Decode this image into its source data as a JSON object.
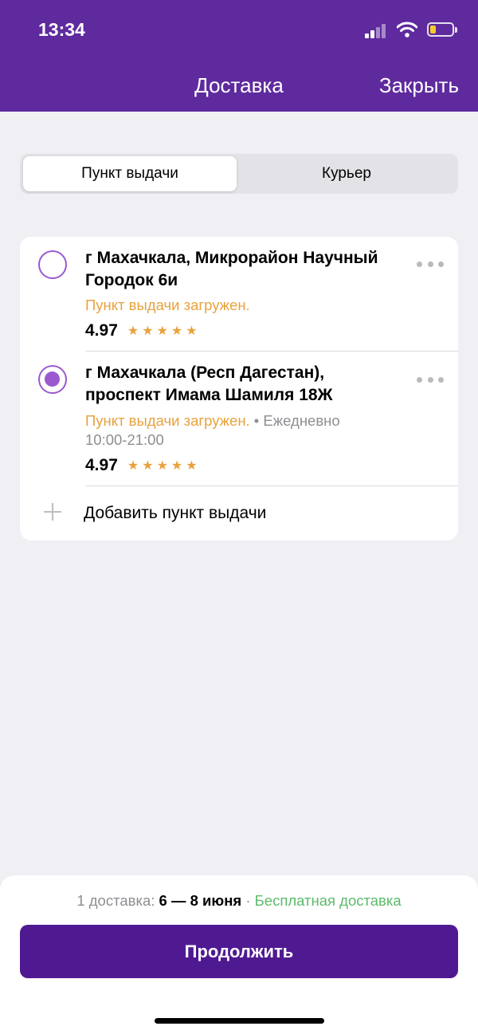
{
  "status_bar": {
    "time": "13:34"
  },
  "header": {
    "title": "Доставка",
    "close_label": "Закрыть"
  },
  "tabs": [
    {
      "label": "Пункт выдачи",
      "selected": true
    },
    {
      "label": "Курьер",
      "selected": false
    }
  ],
  "pickup_points": [
    {
      "address": "г Махачкала, Микрорайон Научный Городок 6и",
      "status": "Пункт выдачи загружен.",
      "hours": "",
      "rating": "4.97",
      "stars": "★★★★★",
      "selected": false
    },
    {
      "address": "г Махачкала (Респ Дагестан), проспект Имама Шамиля 18Ж",
      "status": "Пункт выдачи загружен.",
      "hours_prefix": " • Ежедневно",
      "hours": "10:00-21:00",
      "rating": "4.97",
      "stars": "★★★★★",
      "selected": true
    }
  ],
  "add_pickup_label": "Добавить пункт выдачи",
  "footer": {
    "count_label": "1 доставка: ",
    "dates": "6 — 8 июня",
    "separator": " · ",
    "free_label": "Бесплатная доставка",
    "continue_label": "Продолжить"
  },
  "colors": {
    "header_bg": "#5f2a9e",
    "accent": "#9b59d0",
    "button_bg": "#4f1a91",
    "warning": "#e8a23e",
    "success": "#5cbb6a"
  }
}
